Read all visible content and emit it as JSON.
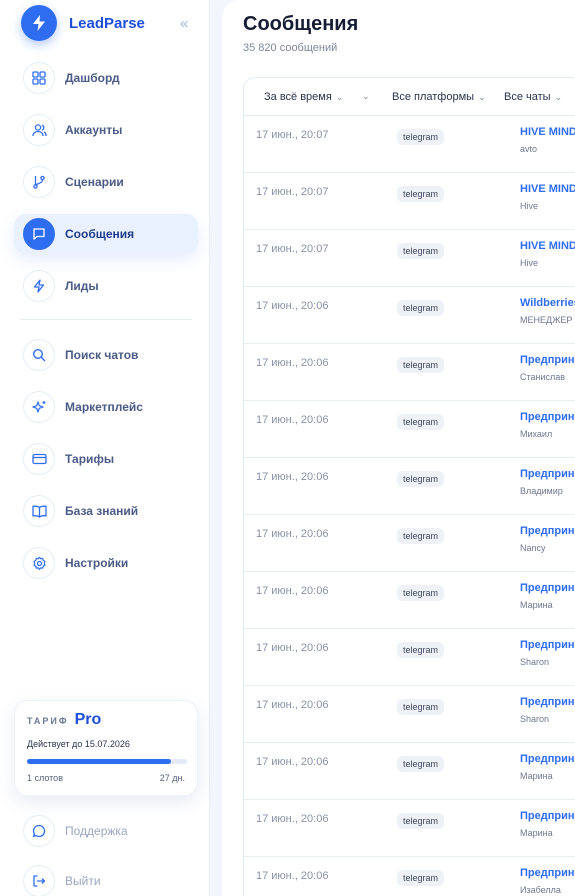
{
  "brand": {
    "name": "LeadParse",
    "collapse_glyph": "«"
  },
  "nav": {
    "items": [
      {
        "label": "Дашборд",
        "icon": "grid-icon"
      },
      {
        "label": "Аккаунты",
        "icon": "users-icon"
      },
      {
        "label": "Сценарии",
        "icon": "git-branch-icon"
      },
      {
        "label": "Сообщения",
        "icon": "message-icon",
        "active": true
      },
      {
        "label": "Лиды",
        "icon": "bolt-icon"
      },
      {
        "label": "Поиск чатов",
        "icon": "search-icon"
      },
      {
        "label": "Маркетплейс",
        "icon": "sparkle-icon"
      },
      {
        "label": "Тарифы",
        "icon": "card-icon"
      },
      {
        "label": "База знаний",
        "icon": "book-icon"
      },
      {
        "label": "Настройки",
        "icon": "gear-icon"
      }
    ],
    "footer": [
      {
        "label": "Поддержка",
        "icon": "chat-bubble-icon"
      },
      {
        "label": "Выйти",
        "icon": "logout-icon"
      }
    ]
  },
  "plan": {
    "kicker": "ТАРИФ",
    "name": "Pro",
    "valid_until": "Действует до 15.07.2026",
    "slots": "1 слотов",
    "days_left": "27 дн.",
    "progress": 0.9
  },
  "page": {
    "title": "Сообщения",
    "subtitle": "35 820 сообщений"
  },
  "filters": {
    "time": "За всё время",
    "platform": "Все платформы",
    "chats": "Все чаты"
  },
  "colors": {
    "accent": "#2f6df0",
    "brand_text": "#1d4fd8"
  },
  "rows": [
    {
      "date": "17 июн., 20:07",
      "platform": "telegram",
      "chat": "HIVE MIND",
      "author": "avto"
    },
    {
      "date": "17 июн., 20:07",
      "platform": "telegram",
      "chat": "HIVE MIND",
      "author": "Hive"
    },
    {
      "date": "17 июн., 20:07",
      "platform": "telegram",
      "chat": "HIVE MIND",
      "author": "Hive"
    },
    {
      "date": "17 июн., 20:06",
      "platform": "telegram",
      "chat": "Wildberries",
      "author": "МЕНЕДЖЕР"
    },
    {
      "date": "17 июн., 20:06",
      "platform": "telegram",
      "chat": "Предприни",
      "author": "Станислав"
    },
    {
      "date": "17 июн., 20:06",
      "platform": "telegram",
      "chat": "Предприни",
      "author": "Михаил"
    },
    {
      "date": "17 июн., 20:06",
      "platform": "telegram",
      "chat": "Предприни",
      "author": "Владимир"
    },
    {
      "date": "17 июн., 20:06",
      "platform": "telegram",
      "chat": "Предприни",
      "author": "Nancy"
    },
    {
      "date": "17 июн., 20:06",
      "platform": "telegram",
      "chat": "Предприни",
      "author": "Марина"
    },
    {
      "date": "17 июн., 20:06",
      "platform": "telegram",
      "chat": "Предприни",
      "author": "Sharon"
    },
    {
      "date": "17 июн., 20:06",
      "platform": "telegram",
      "chat": "Предприни",
      "author": "Sharon"
    },
    {
      "date": "17 июн., 20:06",
      "platform": "telegram",
      "chat": "Предприни",
      "author": "Марина"
    },
    {
      "date": "17 июн., 20:06",
      "platform": "telegram",
      "chat": "Предприни",
      "author": "Марина"
    },
    {
      "date": "17 июн., 20:06",
      "platform": "telegram",
      "chat": "Предприни",
      "author": "Изабелла"
    }
  ]
}
